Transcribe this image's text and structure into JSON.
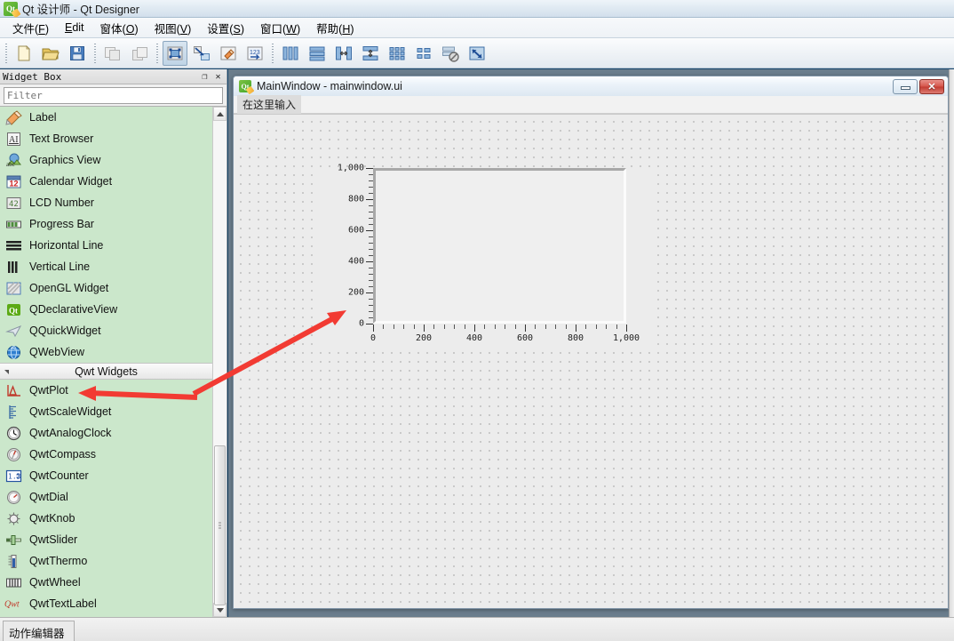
{
  "window": {
    "title": "Qt 设计师 - Qt Designer",
    "logo_text": "Qt"
  },
  "menubar": {
    "items": [
      {
        "label": "文件(F)",
        "accel": "F",
        "pre": "文件(",
        "post": ")"
      },
      {
        "label": "Edit",
        "accel": "E",
        "pre": "",
        "post": "dit"
      },
      {
        "label": "窗体(O)",
        "accel": "O",
        "pre": "窗体(",
        "post": ")"
      },
      {
        "label": "视图(V)",
        "accel": "V",
        "pre": "视图(",
        "post": ")"
      },
      {
        "label": "设置(S)",
        "accel": "S",
        "pre": "设置(",
        "post": ")"
      },
      {
        "label": "窗口(W)",
        "accel": "W",
        "pre": "窗口(",
        "post": ")"
      },
      {
        "label": "帮助(H)",
        "accel": "H",
        "pre": "帮助(",
        "post": ")"
      }
    ]
  },
  "toolbar": {
    "buttons": [
      {
        "name": "new-form-button",
        "icon": "new-document-icon"
      },
      {
        "name": "open-form-button",
        "icon": "open-folder-icon"
      },
      {
        "name": "save-form-button",
        "icon": "floppy-save-icon"
      },
      {
        "name": "undo-button",
        "icon": "undo-copy-icon"
      },
      {
        "name": "redo-button",
        "icon": "redo-copy-icon"
      },
      {
        "name": "edit-widgets-button",
        "icon": "edit-widgets-icon"
      },
      {
        "name": "edit-signals-slots-button",
        "icon": "signals-slots-icon"
      },
      {
        "name": "edit-buddies-button",
        "icon": "buddy-edit-icon"
      },
      {
        "name": "edit-tab-order-button",
        "icon": "tab-order-icon"
      },
      {
        "name": "layout-horizontally-button",
        "icon": "layout-horizontal-icon"
      },
      {
        "name": "layout-vertically-button",
        "icon": "layout-vertical-icon"
      },
      {
        "name": "layout-splitter-horizontal-button",
        "icon": "splitter-horizontal-icon"
      },
      {
        "name": "layout-splitter-vertical-button",
        "icon": "splitter-vertical-icon"
      },
      {
        "name": "layout-grid-button",
        "icon": "layout-grid-icon"
      },
      {
        "name": "layout-form-button",
        "icon": "layout-form-icon"
      },
      {
        "name": "break-layout-button",
        "icon": "break-layout-icon"
      },
      {
        "name": "adjust-size-button",
        "icon": "adjust-size-icon"
      }
    ]
  },
  "widget_box": {
    "title": "Widget Box",
    "undock_glyph": "❐",
    "close_glyph": "✕",
    "filter": {
      "value": "",
      "placeholder": "Filter"
    },
    "items": [
      {
        "label": "Label",
        "icon": "label-icon",
        "type": "widget"
      },
      {
        "label": "Text Browser",
        "icon": "text-browser-icon",
        "type": "widget"
      },
      {
        "label": "Graphics View",
        "icon": "graphics-view-icon",
        "type": "widget"
      },
      {
        "label": "Calendar Widget",
        "icon": "calendar-widget-icon",
        "type": "widget"
      },
      {
        "label": "LCD Number",
        "icon": "lcd-number-icon",
        "type": "widget"
      },
      {
        "label": "Progress Bar",
        "icon": "progress-bar-icon",
        "type": "widget"
      },
      {
        "label": "Horizontal Line",
        "icon": "horizontal-line-icon",
        "type": "widget"
      },
      {
        "label": "Vertical Line",
        "icon": "vertical-line-icon",
        "type": "widget"
      },
      {
        "label": "OpenGL Widget",
        "icon": "opengl-widget-icon",
        "type": "widget"
      },
      {
        "label": "QDeclarativeView",
        "icon": "qdeclarativeview-icon",
        "type": "widget"
      },
      {
        "label": "QQuickWidget",
        "icon": "qquickwidget-icon",
        "type": "widget"
      },
      {
        "label": "QWebView",
        "icon": "qwebview-icon",
        "type": "widget"
      },
      {
        "label": "Qwt Widgets",
        "icon": "category-expand-icon",
        "type": "category"
      },
      {
        "label": "QwtPlot",
        "icon": "qwtplot-icon",
        "type": "widget"
      },
      {
        "label": "QwtScaleWidget",
        "icon": "qwtscalewidget-icon",
        "type": "widget"
      },
      {
        "label": "QwtAnalogClock",
        "icon": "qwtanalogclock-icon",
        "type": "widget"
      },
      {
        "label": "QwtCompass",
        "icon": "qwtcompass-icon",
        "type": "widget"
      },
      {
        "label": "QwtCounter",
        "icon": "qwtcounter-icon",
        "type": "widget"
      },
      {
        "label": "QwtDial",
        "icon": "qwtdial-icon",
        "type": "widget"
      },
      {
        "label": "QwtKnob",
        "icon": "qwtknob-icon",
        "type": "widget"
      },
      {
        "label": "QwtSlider",
        "icon": "qwtslider-icon",
        "type": "widget"
      },
      {
        "label": "QwtThermo",
        "icon": "qwtthermo-icon",
        "type": "widget"
      },
      {
        "label": "QwtWheel",
        "icon": "qwtwheel-icon",
        "type": "widget"
      },
      {
        "label": "QwtTextLabel",
        "icon": "qwttextlabel-icon",
        "type": "widget"
      }
    ]
  },
  "form_window": {
    "title": "MainWindow - mainwindow.ui",
    "menubar_placeholder": "在这里输入",
    "minimize_label": "",
    "close_label": "✕"
  },
  "statusbar": {
    "tab_label": "动作编辑器"
  },
  "colors": {
    "widget_list_background": "#cbe7cb",
    "annotation_red": "#f23b33",
    "plot_canvas": "#efefef",
    "form_grid_dot": "#bdbdbd"
  },
  "chart_data": {
    "type": "line",
    "title": "",
    "xlabel": "",
    "ylabel": "",
    "xlim": [
      0,
      1000
    ],
    "ylim": [
      0,
      1000
    ],
    "x_ticks": [
      0,
      200,
      400,
      600,
      800,
      1000
    ],
    "x_tick_labels": [
      "0",
      "200",
      "400",
      "600",
      "800",
      "1,000"
    ],
    "y_ticks": [
      0,
      200,
      400,
      600,
      800,
      1000
    ],
    "y_tick_labels": [
      "0",
      "200",
      "400",
      "600",
      "800",
      "1,000"
    ],
    "x_minor_per_major": 5,
    "y_minor_per_major": 5,
    "grid": false,
    "legend": null,
    "series": []
  },
  "annotations": [
    {
      "name": "arrow-to-plot",
      "from": [
        215,
        440
      ],
      "to": [
        388,
        352
      ],
      "color": "#f23b33"
    },
    {
      "name": "arrow-to-qwtplot-item",
      "from": [
        222,
        446
      ],
      "to": [
        90,
        442
      ],
      "color": "#f23b33"
    }
  ]
}
